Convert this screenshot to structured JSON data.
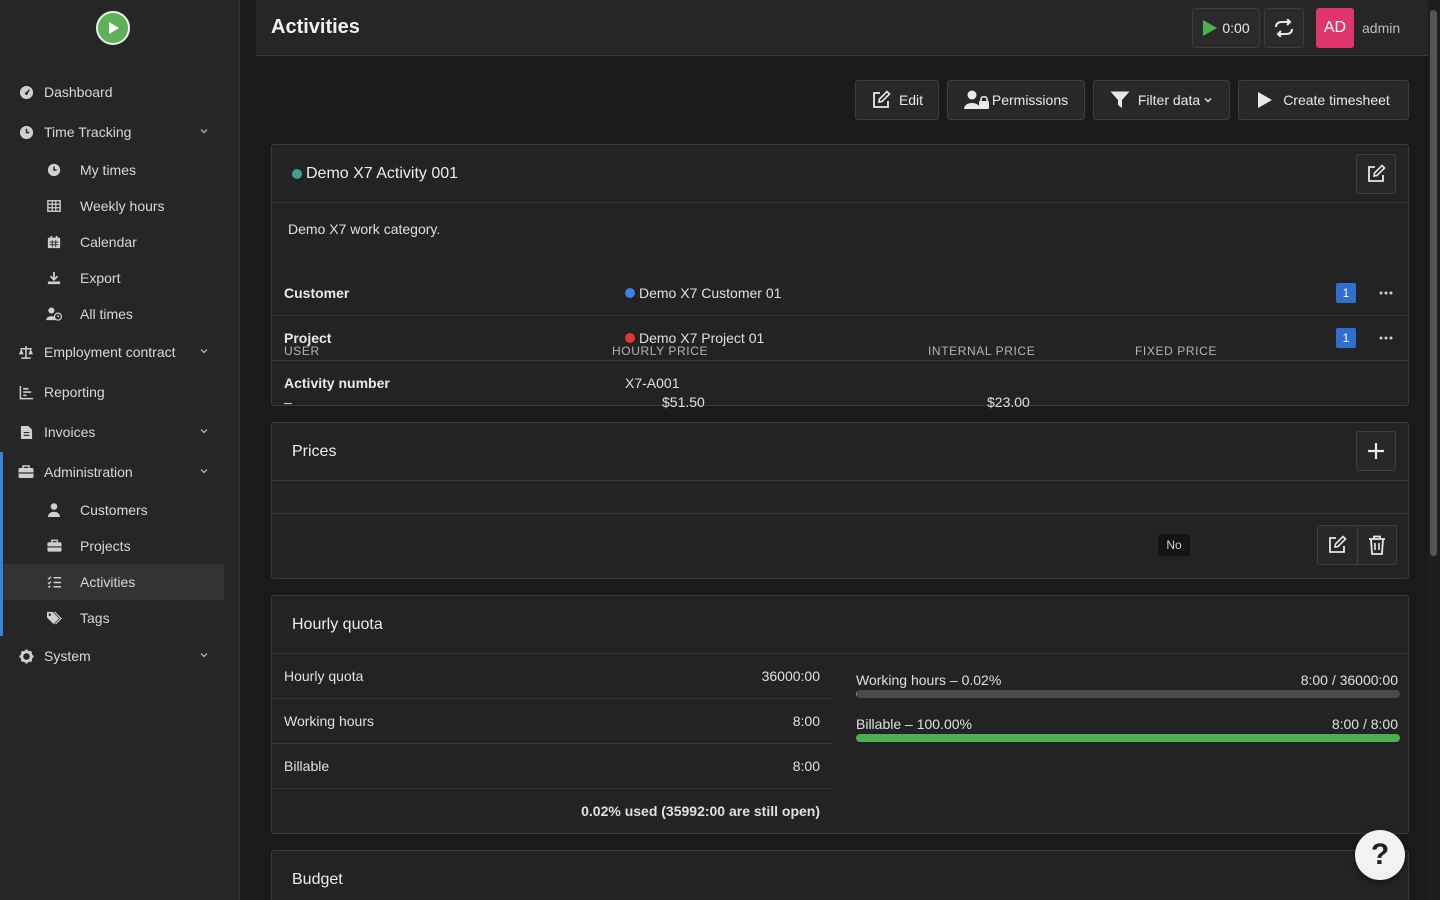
{
  "app": {
    "page_title": "Activities"
  },
  "header": {
    "timer": "0:00",
    "avatar_initials": "AD",
    "username": "admin"
  },
  "sidebar": {
    "dashboard": "Dashboard",
    "time_tracking": "Time Tracking",
    "my_times": "My times",
    "weekly_hours": "Weekly hours",
    "calendar": "Calendar",
    "export": "Export",
    "all_times": "All times",
    "employment_contract": "Employment contract",
    "reporting": "Reporting",
    "invoices": "Invoices",
    "administration": "Administration",
    "customers": "Customers",
    "projects": "Projects",
    "activities": "Activities",
    "tags": "Tags",
    "system": "System"
  },
  "actions": {
    "edit": "Edit",
    "permissions": "Permissions",
    "filter": "Filter data",
    "create_timesheet": "Create timesheet"
  },
  "activity": {
    "name": "Demo X7 Activity 001",
    "description": "Demo X7 work category.",
    "customer_label": "Customer",
    "customer_value": "Demo X7 Customer 01",
    "customer_count": "1",
    "project_label": "Project",
    "project_value": "Demo X7 Project 01",
    "project_count": "1",
    "number_label": "Activity number",
    "number_value": "X7-A001"
  },
  "prices": {
    "title": "Prices",
    "headers": {
      "user": "USER",
      "hourly": "HOURLY PRICE",
      "internal": "INTERNAL PRICE",
      "fixed": "FIXED PRICE"
    },
    "row": {
      "user": "–",
      "hourly": "$51.50",
      "internal": "$23.00",
      "fixed": "No"
    }
  },
  "quota": {
    "title": "Hourly quota",
    "rows": [
      {
        "label": "Hourly quota",
        "value": "36000:00"
      },
      {
        "label": "Working hours",
        "value": "8:00"
      },
      {
        "label": "Billable",
        "value": "8:00"
      }
    ],
    "summary": "0.02% used (35992:00 are still open)",
    "bars": [
      {
        "label": "Working hours – 0.02%",
        "value": "8:00 / 36000:00",
        "percent": 0.02
      },
      {
        "label": "Billable – 100.00%",
        "value": "8:00 / 8:00",
        "percent": 100
      }
    ]
  },
  "budget": {
    "title": "Budget"
  },
  "colors": {
    "activity_dot": "#3fa08f",
    "customer_dot": "#3b82e6",
    "project_dot": "#e0392f",
    "accent": "#3b82d6",
    "progress": "#4caf50",
    "avatar": "#e0356a"
  }
}
